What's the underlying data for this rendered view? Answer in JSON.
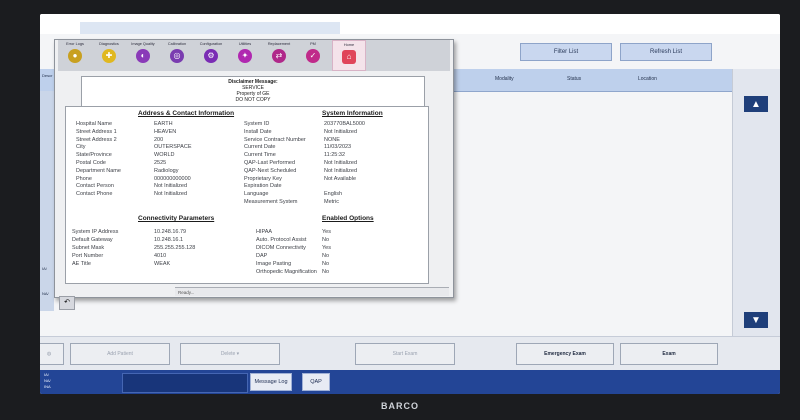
{
  "brand": "BARCO",
  "top_buttons": {
    "filter": "Filter List",
    "refresh": "Refresh List"
  },
  "columns": [
    "Modality",
    "Status",
    "Location"
  ],
  "left_strip": [
    "Descr",
    "IA/",
    "NA/"
  ],
  "toolbar": [
    {
      "label": "Error Logs",
      "icon": "error-log-icon",
      "color": "#c8a020"
    },
    {
      "label": "Diagnostics",
      "icon": "diagnostics-icon",
      "color": "#e0b820"
    },
    {
      "label": "Image Quality",
      "icon": "image-quality-icon",
      "color": "#8a3ab8"
    },
    {
      "label": "Calibration",
      "icon": "calibration-icon",
      "color": "#7a3cb0"
    },
    {
      "label": "Configuration",
      "icon": "configuration-icon",
      "color": "#7a2cb4"
    },
    {
      "label": "Utilities",
      "icon": "utilities-icon",
      "color": "#b028b0"
    },
    {
      "label": "Replacement",
      "icon": "replacement-icon",
      "color": "#b0288a"
    },
    {
      "label": "PM",
      "icon": "pm-icon",
      "color": "#c02a8a"
    },
    {
      "label": "Home",
      "icon": "home-icon",
      "color": "#e0455a"
    }
  ],
  "disclaimer": {
    "heading": "Disclaimer Message:",
    "line1": "SERVICE",
    "line2": "Property of GE",
    "line3": "DO NOT COPY"
  },
  "address": {
    "title": "Address & Contact Information",
    "rows": [
      {
        "label": "Hospital Name",
        "value": "EARTH"
      },
      {
        "label": "Street Address 1",
        "value": "HEAVEN"
      },
      {
        "label": "Street Address 2",
        "value": "200"
      },
      {
        "label": "City",
        "value": "OUTERSPACE"
      },
      {
        "label": "State/Province",
        "value": "WORLD"
      },
      {
        "label": "Postal Code",
        "value": "2525"
      },
      {
        "label": "Department Name",
        "value": "Radiology"
      },
      {
        "label": "Phone",
        "value": "000000000000"
      },
      {
        "label": "Contact Person",
        "value": "Not Initialized"
      },
      {
        "label": "Contact Phone",
        "value": "Not Initialized"
      }
    ]
  },
  "system": {
    "title": "System Information",
    "rows": [
      {
        "label": "System ID",
        "value": "203770BAL5000"
      },
      {
        "label": "Install Date",
        "value": "Not Initialized"
      },
      {
        "label": "Service Contract Number",
        "value": "NONE"
      },
      {
        "label": "Current Date",
        "value": "11/03/2023"
      },
      {
        "label": "Current Time",
        "value": "11:25:32"
      },
      {
        "label": "QAP-Last Performed",
        "value": "Not Initialized"
      },
      {
        "label": "QAP-Next Scheduled",
        "value": "Not Initialized"
      },
      {
        "label": "Proprietary Key",
        "value": "Not Available"
      },
      {
        "label": "Expiration Date",
        "value": ""
      },
      {
        "label": "Language",
        "value": "English"
      },
      {
        "label": "Measurement System",
        "value": "Metric"
      }
    ]
  },
  "connectivity": {
    "title": "Connectivity Parameters",
    "rows": [
      {
        "label": "System IP Address",
        "value": "10.248.16.79"
      },
      {
        "label": "Default Gateway",
        "value": "10.248.16.1"
      },
      {
        "label": "Subnet Mask",
        "value": "255.255.255.128"
      },
      {
        "label": "Port Number",
        "value": "4010"
      },
      {
        "label": "AE Title",
        "value": "WEAK"
      }
    ]
  },
  "options": {
    "title": "Enabled Options",
    "rows": [
      {
        "label": "HIPAA",
        "value": "Yes"
      },
      {
        "label": "Auto. Protocol Assist",
        "value": "No"
      },
      {
        "label": "DICOM Connectivity",
        "value": "Yes"
      },
      {
        "label": "DAP",
        "value": "No"
      },
      {
        "label": "Image Pasting",
        "value": "No"
      },
      {
        "label": "Orthopedic Magnification",
        "value": "No"
      }
    ]
  },
  "status": "Ready...",
  "bottom": {
    "add_patient": "Add Patient",
    "delete": "Delete",
    "start_exam": "Start Exam",
    "emergency": "Emergency Exam",
    "exam2": "Exam"
  },
  "statusbar": {
    "left1": "IA/",
    "left2": "NA/",
    "left3": "INA",
    "message_log": "Message Log",
    "qap": "QAP"
  }
}
